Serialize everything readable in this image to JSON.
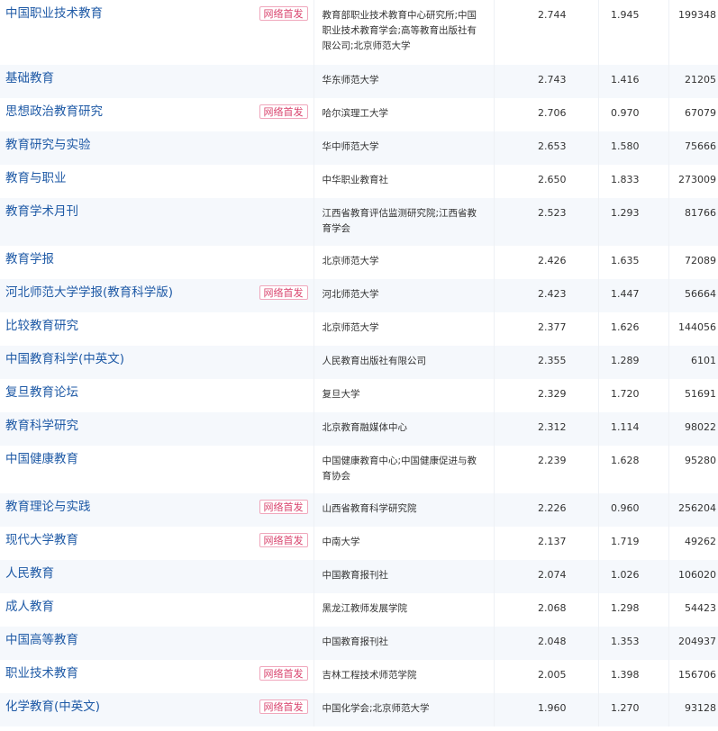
{
  "badge_label": "网络首发",
  "rows": [
    {
      "name": "中国职业技术教育",
      "first": true,
      "publisher": "教育部职业技术教育中心研究所;中国职业技术教育学会;高等教育出版社有限公司;北京师范大学",
      "v1": "2.744",
      "v2": "1.945",
      "v3": "199348"
    },
    {
      "name": "基础教育",
      "first": false,
      "publisher": "华东师范大学",
      "v1": "2.743",
      "v2": "1.416",
      "v3": "21205"
    },
    {
      "name": "思想政治教育研究",
      "first": true,
      "publisher": "哈尔滨理工大学",
      "v1": "2.706",
      "v2": "0.970",
      "v3": "67079"
    },
    {
      "name": "教育研究与实验",
      "first": false,
      "publisher": "华中师范大学",
      "v1": "2.653",
      "v2": "1.580",
      "v3": "75666"
    },
    {
      "name": "教育与职业",
      "first": false,
      "publisher": "中华职业教育社",
      "v1": "2.650",
      "v2": "1.833",
      "v3": "273009"
    },
    {
      "name": "教育学术月刊",
      "first": false,
      "publisher": "江西省教育评估监测研究院;江西省教育学会",
      "v1": "2.523",
      "v2": "1.293",
      "v3": "81766"
    },
    {
      "name": "教育学报",
      "first": false,
      "publisher": "北京师范大学",
      "v1": "2.426",
      "v2": "1.635",
      "v3": "72089"
    },
    {
      "name": "河北师范大学学报(教育科学版)",
      "first": true,
      "publisher": "河北师范大学",
      "v1": "2.423",
      "v2": "1.447",
      "v3": "56664"
    },
    {
      "name": "比较教育研究",
      "first": false,
      "publisher": "北京师范大学",
      "v1": "2.377",
      "v2": "1.626",
      "v3": "144056"
    },
    {
      "name": "中国教育科学(中英文)",
      "first": false,
      "publisher": "人民教育出版社有限公司",
      "v1": "2.355",
      "v2": "1.289",
      "v3": "6101"
    },
    {
      "name": "复旦教育论坛",
      "first": false,
      "publisher": "复旦大学",
      "v1": "2.329",
      "v2": "1.720",
      "v3": "51691"
    },
    {
      "name": "教育科学研究",
      "first": false,
      "publisher": "北京教育融媒体中心",
      "v1": "2.312",
      "v2": "1.114",
      "v3": "98022"
    },
    {
      "name": "中国健康教育",
      "first": false,
      "publisher": "中国健康教育中心;中国健康促进与教育协会",
      "v1": "2.239",
      "v2": "1.628",
      "v3": "95280"
    },
    {
      "name": "教育理论与实践",
      "first": true,
      "publisher": "山西省教育科学研究院",
      "v1": "2.226",
      "v2": "0.960",
      "v3": "256204"
    },
    {
      "name": "现代大学教育",
      "first": true,
      "publisher": "中南大学",
      "v1": "2.137",
      "v2": "1.719",
      "v3": "49262"
    },
    {
      "name": "人民教育",
      "first": false,
      "publisher": "中国教育报刊社",
      "v1": "2.074",
      "v2": "1.026",
      "v3": "106020"
    },
    {
      "name": "成人教育",
      "first": false,
      "publisher": "黑龙江教师发展学院",
      "v1": "2.068",
      "v2": "1.298",
      "v3": "54423"
    },
    {
      "name": "中国高等教育",
      "first": false,
      "publisher": "中国教育报刊社",
      "v1": "2.048",
      "v2": "1.353",
      "v3": "204937"
    },
    {
      "name": "职业技术教育",
      "first": true,
      "publisher": "吉林工程技术师范学院",
      "v1": "2.005",
      "v2": "1.398",
      "v3": "156706"
    },
    {
      "name": "化学教育(中英文)",
      "first": true,
      "publisher": "中国化学会;北京师范大学",
      "v1": "1.960",
      "v2": "1.270",
      "v3": "93128"
    }
  ]
}
